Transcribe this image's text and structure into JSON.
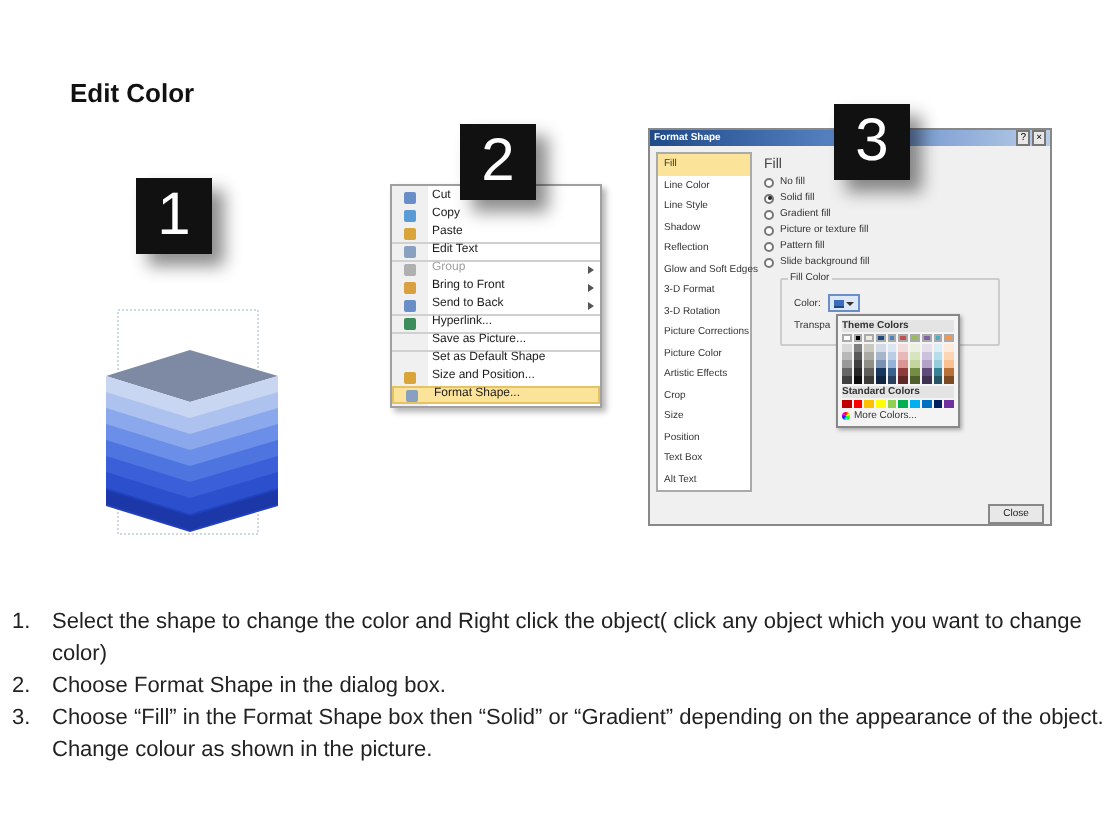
{
  "title": "Edit Color",
  "badges": [
    "1",
    "2",
    "3"
  ],
  "context_menu": {
    "items": [
      {
        "label": "Cut",
        "submenu": false,
        "disabled": false,
        "selected": false,
        "divider_before": false
      },
      {
        "label": "Copy",
        "submenu": false,
        "disabled": false,
        "selected": false,
        "divider_before": false
      },
      {
        "label": "Paste",
        "submenu": false,
        "disabled": false,
        "selected": false,
        "divider_before": false
      },
      {
        "label": "Edit Text",
        "submenu": false,
        "disabled": false,
        "selected": false,
        "divider_before": true
      },
      {
        "label": "Group",
        "submenu": true,
        "disabled": true,
        "selected": false,
        "divider_before": true
      },
      {
        "label": "Bring to Front",
        "submenu": true,
        "disabled": false,
        "selected": false,
        "divider_before": false
      },
      {
        "label": "Send to Back",
        "submenu": true,
        "disabled": false,
        "selected": false,
        "divider_before": false
      },
      {
        "label": "Hyperlink...",
        "submenu": false,
        "disabled": false,
        "selected": false,
        "divider_before": true
      },
      {
        "label": "Save as Picture...",
        "submenu": false,
        "disabled": false,
        "selected": false,
        "divider_before": true
      },
      {
        "label": "Set as Default Shape",
        "submenu": false,
        "disabled": false,
        "selected": false,
        "divider_before": true
      },
      {
        "label": "Size and Position...",
        "submenu": false,
        "disabled": false,
        "selected": false,
        "divider_before": false
      },
      {
        "label": "Format Shape...",
        "submenu": false,
        "disabled": false,
        "selected": true,
        "divider_before": false
      }
    ]
  },
  "dialog": {
    "title": "Format Shape",
    "title_buttons": [
      "?",
      "×"
    ],
    "nav": [
      {
        "label": "Fill",
        "selected": true
      },
      {
        "label": "Line Color",
        "selected": false
      },
      {
        "label": "Line Style",
        "selected": false
      },
      {
        "label": "Shadow",
        "selected": false
      },
      {
        "label": "Reflection",
        "selected": false
      },
      {
        "label": "Glow and Soft Edges",
        "selected": false
      },
      {
        "label": "3-D Format",
        "selected": false
      },
      {
        "label": "3-D Rotation",
        "selected": false
      },
      {
        "label": "Picture Corrections",
        "selected": false
      },
      {
        "label": "Picture Color",
        "selected": false
      },
      {
        "label": "Artistic Effects",
        "selected": false
      },
      {
        "label": "Crop",
        "selected": false
      },
      {
        "label": "Size",
        "selected": false
      },
      {
        "label": "Position",
        "selected": false
      },
      {
        "label": "Text Box",
        "selected": false
      },
      {
        "label": "Alt Text",
        "selected": false
      }
    ],
    "heading": "Fill",
    "options": [
      {
        "label": "No fill",
        "selected": false
      },
      {
        "label": "Solid fill",
        "selected": true
      },
      {
        "label": "Gradient fill",
        "selected": false
      },
      {
        "label": "Picture or texture fill",
        "selected": false
      },
      {
        "label": "Pattern fill",
        "selected": false
      },
      {
        "label": "Slide background fill",
        "selected": false
      }
    ],
    "group_label": "Fill Color",
    "color_label": "Color:",
    "transparency_label": "Transpa",
    "palette": {
      "theme_heading": "Theme Colors",
      "theme": [
        {
          "color": "#ffffff"
        },
        {
          "color": "#000000"
        },
        {
          "color": "#eeece1"
        },
        {
          "color": "#1f497d"
        },
        {
          "color": "#4f81bd"
        },
        {
          "color": "#c0504d"
        },
        {
          "color": "#9bbb59"
        },
        {
          "color": "#8064a2"
        },
        {
          "color": "#4bacc6"
        },
        {
          "color": "#f79646"
        }
      ],
      "standard_heading": "Standard Colors",
      "standard": [
        {
          "color": "#c00000"
        },
        {
          "color": "#ff0000"
        },
        {
          "color": "#ffc000"
        },
        {
          "color": "#ffff00"
        },
        {
          "color": "#92d050"
        },
        {
          "color": "#00b050"
        },
        {
          "color": "#00b0f0"
        },
        {
          "color": "#0070c0"
        },
        {
          "color": "#002060"
        },
        {
          "color": "#7030a0"
        }
      ],
      "more": "More Colors..."
    },
    "close": "Close"
  },
  "instructions": [
    {
      "number": "1.",
      "text": "Select the shape to change the color and Right click the object( click any object which you want to change color)"
    },
    {
      "number": "2.",
      "text": "Choose Format Shape in the dialog box."
    },
    {
      "number": "3.",
      "text": "Choose “Fill” in the Format Shape box then “Solid” or “Gradient” depending on the appearance of the object. Change colour as shown in the picture."
    }
  ]
}
